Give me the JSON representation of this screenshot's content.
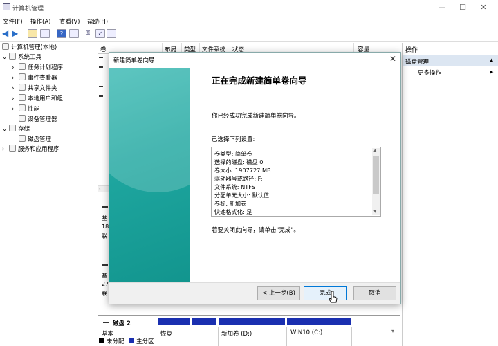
{
  "window": {
    "title": "计算机管理",
    "minimize": "—",
    "maximize": "☐",
    "close": "✕"
  },
  "menu": [
    "文件(F)",
    "操作(A)",
    "查看(V)",
    "帮助(H)"
  ],
  "tree": [
    {
      "label": "计算机管理(本地)",
      "expander": "",
      "icon": "computer-icon"
    },
    {
      "label": "系统工具",
      "expander": "⌄",
      "icon": "tools-icon"
    },
    {
      "label": "任务计划程序",
      "expander": "›",
      "icon": "clock-icon"
    },
    {
      "label": "事件查看器",
      "expander": "›",
      "icon": "event-log-icon"
    },
    {
      "label": "共享文件夹",
      "expander": "›",
      "icon": "shared-folder-icon"
    },
    {
      "label": "本地用户和组",
      "expander": "›",
      "icon": "users-icon"
    },
    {
      "label": "性能",
      "expander": "›",
      "icon": "performance-icon"
    },
    {
      "label": "设备管理器",
      "expander": "",
      "icon": "device-manager-icon"
    },
    {
      "label": "存储",
      "expander": "⌄",
      "icon": "storage-icon"
    },
    {
      "label": "磁盘管理",
      "expander": "",
      "icon": "disk-icon"
    },
    {
      "label": "服务和应用程序",
      "expander": "›",
      "icon": "services-icon"
    }
  ],
  "columns": [
    "卷",
    "布局",
    "类型",
    "文件系统",
    "状态",
    "容量"
  ],
  "disks": {
    "rows": [
      {
        "label": "基",
        "size": "18",
        "state": "联"
      },
      {
        "label": "基",
        "size": "27",
        "state": "联"
      }
    ],
    "disk2": {
      "name": "磁盘 2",
      "type": "基本",
      "vol_recover": "恢复",
      "vol_new": "新加卷 (D:)",
      "vol_win": "WIN10 (C:)"
    },
    "legend": {
      "unalloc": "未分配",
      "primary": "主分区"
    }
  },
  "actions": {
    "header": "操作",
    "selected": "磁盘管理",
    "more": "更多操作",
    "selected_arrow": "▲",
    "more_arrow": "▶"
  },
  "wizard": {
    "title": "新建简单卷向导",
    "close": "✕",
    "heading": "正在完成新建简单卷向导",
    "done_text": "你已经成功完成新建简单卷向导。",
    "settings_label": "已选择下列设置:",
    "settings": [
      "卷类型: 简单卷",
      "选择的磁盘: 磁盘 0",
      "卷大小: 1907727 MB",
      "驱动器号或路径: F:",
      "文件系统: NTFS",
      "分配单元大小: 默认值",
      "卷标: 新加卷",
      "快速格式化: 是"
    ],
    "close_hint": "若要关闭此向导，请单击\"完成\"。",
    "back_button": "< 上一步(B)",
    "finish_button": "完成",
    "cancel_button": "取消"
  },
  "colors": {
    "accent": "#0078d7",
    "disk_bar": "#1a2fb0",
    "wizard_side": "#1fa7a0"
  }
}
